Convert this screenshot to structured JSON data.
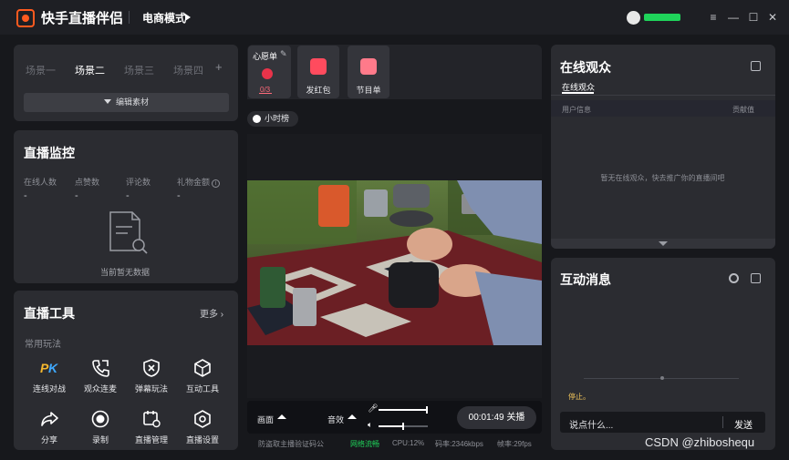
{
  "titlebar": {
    "app_name": "快手直播伴侣",
    "mode": "电商模式",
    "window_buttons": [
      "menu-icon",
      "minimize-icon",
      "maximize-icon",
      "close-icon"
    ]
  },
  "scenes": {
    "tabs": [
      "场景一",
      "场景二",
      "场景三",
      "场景四"
    ],
    "active_index": 1,
    "add": "+",
    "edit_label": "编辑素材"
  },
  "monitor": {
    "title": "直播监控",
    "stats": [
      {
        "label": "在线人数",
        "value": "-"
      },
      {
        "label": "点赞数",
        "value": "-"
      },
      {
        "label": "评论数",
        "value": "-"
      },
      {
        "label": "礼物金额",
        "value": "-"
      }
    ],
    "empty_text": "当前暂无数据"
  },
  "tools": {
    "title": "直播工具",
    "more_label": "更多",
    "section_label": "常用玩法",
    "items": [
      {
        "label": "连线对战",
        "icon": "pk-icon"
      },
      {
        "label": "观众连麦",
        "icon": "phone-icon"
      },
      {
        "label": "弹幕玩法",
        "icon": "barrage-icon"
      },
      {
        "label": "互动工具",
        "icon": "cube-icon"
      },
      {
        "label": "分享",
        "icon": "share-icon"
      },
      {
        "label": "录制",
        "icon": "record-icon"
      },
      {
        "label": "直播管理",
        "icon": "manage-icon"
      },
      {
        "label": "直播设置",
        "icon": "settings-icon"
      }
    ]
  },
  "center": {
    "wish_title": "心愿单",
    "wish_count": "0/3",
    "red_packet_label": "发红包",
    "program_label": "节目单",
    "hour_rank": "小时榜",
    "picture_label": "画面",
    "sound_label": "音效",
    "timer": "00:01:49",
    "close_label": "关播",
    "footer_notice": "防盗取主播验证码公",
    "footer_network": "网络流畅",
    "footer_cpu": "CPU:12%",
    "footer_bitrate": "码率:2346kbps",
    "footer_fps": "帧率:29fps",
    "mic_level": 1.0,
    "speaker_level": 0.5
  },
  "audience": {
    "title": "在线观众",
    "tab": "在线观众",
    "col_user": "用户信息",
    "col_contrib": "贡献值",
    "empty_text": "暂无在线观众，快去推广你的直播间吧"
  },
  "messages": {
    "title": "互动消息",
    "stop_text": "停止。",
    "input_placeholder": "说点什么...",
    "send_label": "发送"
  },
  "watermark": "CSDN @zhiboshequ",
  "colors": {
    "accent": "#ff5a1f",
    "network_ok": "#1fd35a",
    "panel_bg": "#2b2c31",
    "app_bg": "#17181c"
  }
}
